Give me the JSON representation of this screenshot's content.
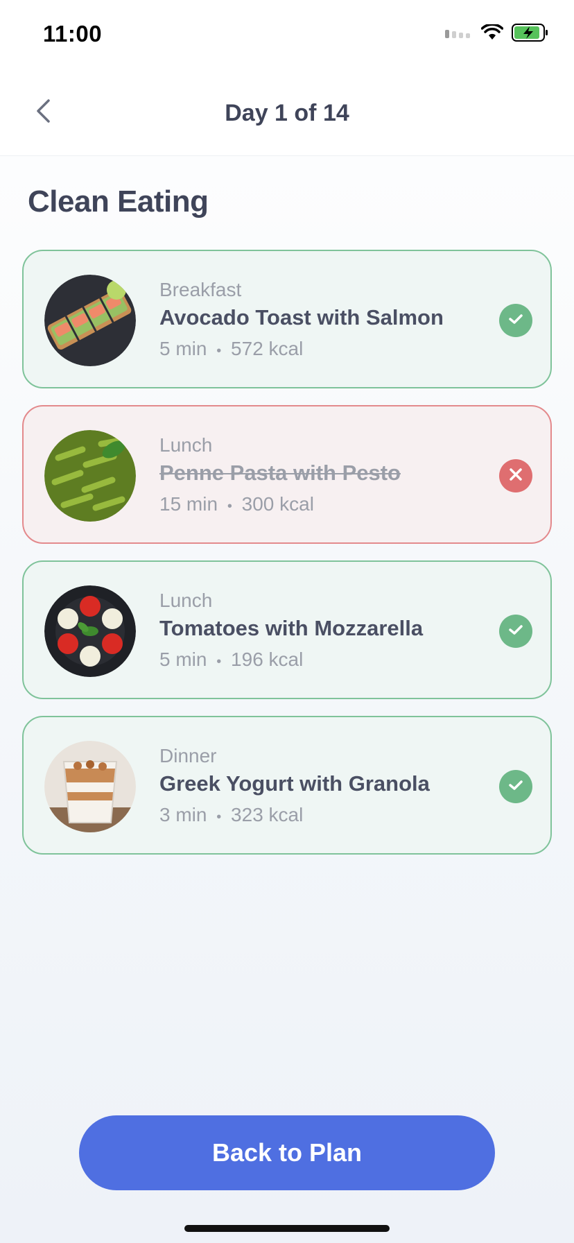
{
  "status_bar": {
    "time": "11:00",
    "icons": [
      "cellular-signal-icon",
      "wifi-icon",
      "battery-charging-icon"
    ]
  },
  "header": {
    "back_icon": "chevron-left-icon",
    "title": "Day 1 of 14"
  },
  "plan": {
    "title": "Clean Eating"
  },
  "meals": [
    {
      "type": "Breakfast",
      "name": "Avocado Toast with Salmon",
      "time": "5 min",
      "separator": "•",
      "calories": "572 kcal",
      "status": "done",
      "image": "avocado-toast-photo"
    },
    {
      "type": "Lunch",
      "name": "Penne Pasta with Pesto",
      "time": "15 min",
      "separator": "•",
      "calories": "300 kcal",
      "status": "skipped",
      "image": "pesto-pasta-photo"
    },
    {
      "type": "Lunch",
      "name": "Tomatoes with Mozzarella",
      "time": "5 min",
      "separator": "•",
      "calories": "196 kcal",
      "status": "done",
      "image": "caprese-photo"
    },
    {
      "type": "Dinner",
      "name": "Greek Yogurt with Granola",
      "time": "3 min",
      "separator": "•",
      "calories": "323 kcal",
      "status": "done",
      "image": "yogurt-granola-photo"
    }
  ],
  "footer": {
    "button_label": "Back to Plan"
  },
  "colors": {
    "accent": "#4f6fe1",
    "done": "#6db888",
    "skipped": "#df6e70",
    "done_border": "#7fc39a",
    "skipped_border": "#e3898c"
  }
}
